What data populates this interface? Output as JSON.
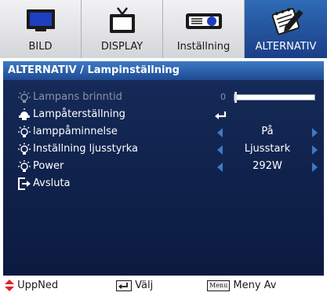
{
  "tabs": [
    {
      "label": "BILD",
      "icon": "monitor-icon",
      "active": false
    },
    {
      "label": "DISPLAY",
      "icon": "tv-icon",
      "active": false
    },
    {
      "label": "Inställning",
      "icon": "projector-icon",
      "active": false
    },
    {
      "label": "ALTERNATIV",
      "icon": "notepad-pencil-icon",
      "active": true
    }
  ],
  "title": "ALTERNATIV / Lampinställning",
  "rows": [
    {
      "label": "Lampans brinntid",
      "icon": "lamp-icon",
      "type": "slider",
      "value_label": "0",
      "value": 0,
      "disabled": true
    },
    {
      "label": "Lampåterställning",
      "icon": "lamp-reset-icon",
      "type": "enter",
      "disabled": false
    },
    {
      "label": "lamppåminnelse",
      "icon": "lamp-icon",
      "type": "select",
      "value": "På",
      "disabled": false
    },
    {
      "label": "Inställning ljusstyrka",
      "icon": "bulb-icon",
      "type": "select",
      "value": "Ljusstark",
      "disabled": false
    },
    {
      "label": "Power",
      "icon": "bulb-icon",
      "type": "select",
      "value": "292W",
      "disabled": false
    },
    {
      "label": "Avsluta",
      "icon": "exit-icon",
      "type": "action",
      "disabled": false
    }
  ],
  "help": [
    {
      "icon": "up-down-arrows-icon",
      "label": "UppNed"
    },
    {
      "icon": "enter-key-icon",
      "label": "Välj"
    },
    {
      "icon": "menu-key-icon",
      "key": "Menu",
      "label": "Meny Av"
    }
  ],
  "colors": {
    "accent": "#3d7ac6",
    "panel": "#0f2048",
    "active_tab": "#1f4b93",
    "help_arrow": "#e0202a"
  }
}
